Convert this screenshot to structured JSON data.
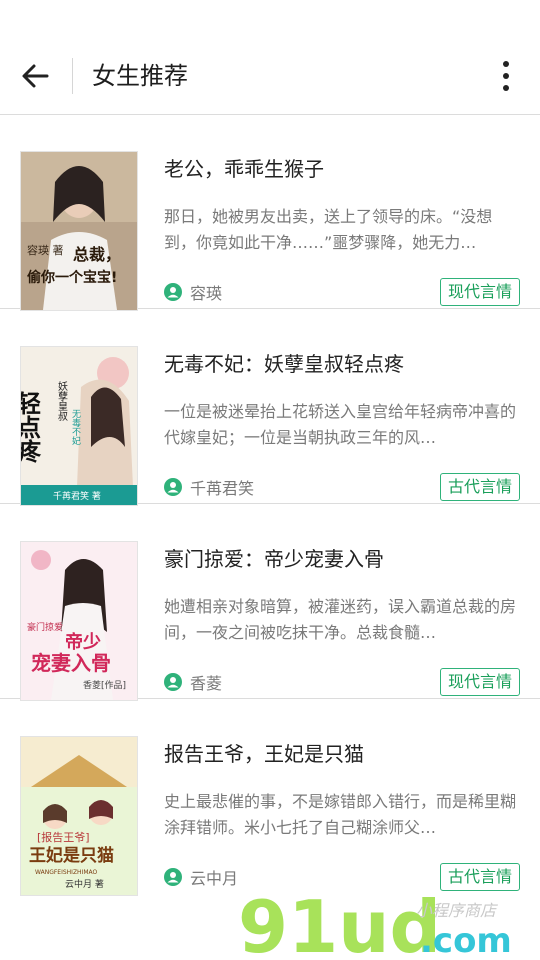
{
  "header": {
    "title": "女生推荐",
    "icons": {
      "back": "back-arrow-icon",
      "more": "more-vertical-icon"
    }
  },
  "books": [
    {
      "title": "老公，乖乖生猴子",
      "desc": "那日，她被男友出卖，送上了领导的床。“没想到，你竟如此干净……”噩梦骤降，她无力…",
      "author": "容瑛",
      "tag": "现代言情",
      "cover_text": [
        "容瑛 著",
        "总裁，",
        "偷你一个宝宝!"
      ]
    },
    {
      "title": "无毒不妃：妖孽皇叔轻点疼",
      "desc": "一位是被迷晕抬上花轿送入皇宫给年轻病帝冲喜的代嫁皇妃；一位是当朝执政三年的风…",
      "author": "千苒君笑",
      "tag": "古代言情",
      "cover_text": [
        "轻点疼",
        "妖孽皇叔",
        "无毒不妃",
        "千苒君笑 著"
      ]
    },
    {
      "title": "豪门掠爱：帝少宠妻入骨",
      "desc": "她遭相亲对象暗算，被灌迷药，误入霸道总裁的房间，一夜之间被吃抹干净。总裁食髓…",
      "author": "香菱",
      "tag": "现代言情",
      "cover_text": [
        "豪门掠爱",
        "帝少",
        "宠妻入骨",
        "香菱[作品]"
      ]
    },
    {
      "title": "报告王爷，王妃是只猫",
      "desc": "史上最悲催的事，不是嫁错郎入错行，而是稀里糊涂拜错师。米小七托了自己糊涂师父…",
      "author": "云中月",
      "tag": "古代言情",
      "cover_text": [
        "[报告王爷]",
        "王妃是只猫",
        "WANGFEISHIZHIMAO",
        "云中月 著"
      ]
    }
  ],
  "watermark": {
    "main": "91ud",
    "suffix": ".com",
    "small": "小程序商店"
  },
  "colors": {
    "accent": "#2fb27a",
    "tag_text": "#1a9f5a",
    "text_secondary": "#7a7a7a"
  }
}
